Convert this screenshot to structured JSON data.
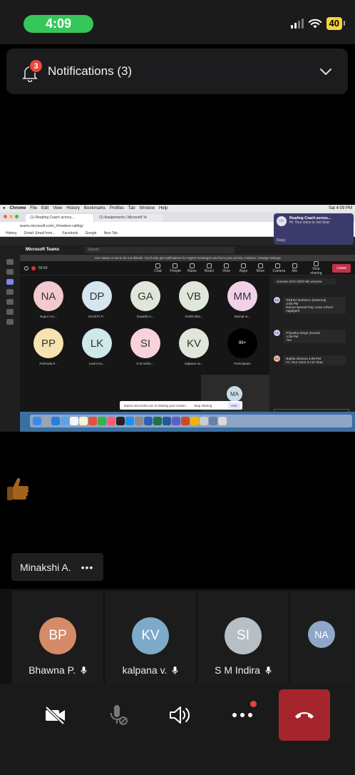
{
  "status_bar": {
    "time": "4:09",
    "battery": "40"
  },
  "notification": {
    "label": "Notifications (3)",
    "badge": "3"
  },
  "shared_screen": {
    "mac_menu": [
      "Chrome",
      "File",
      "Edit",
      "View",
      "History",
      "Bookmarks",
      "Profiles",
      "Tab",
      "Window",
      "Help"
    ],
    "mac_status": "Sat 4:09 PM",
    "tabs": [
      "(1) Reading Coach across...",
      "(1) Assignments | Microsoft Te"
    ],
    "url": "teams.microsoft.com/_#/modern-calling/",
    "bookmarks": [
      "History",
      "Gmail: Email from...",
      "Facebook",
      "Google",
      "New Tab"
    ],
    "mac_notification": {
      "initials": "UU",
      "title": "Reading Coach across...",
      "body": "Hi. Your voice is not clear",
      "reply": "Reply"
    },
    "teams_name": "Microsoft Teams",
    "teams_search": "Search",
    "dnd_banner": "Your status is set to do not disturb. You'll only get notifications for urgent messages and from your priority contacts. Change settings",
    "meeting_timer": "59:43",
    "toolbar": [
      "Chat",
      "People",
      "Raise",
      "React",
      "View",
      "Apps",
      "More",
      "Camera",
      "Mic",
      "Stop sharing"
    ],
    "leave": "Leave",
    "tiles": [
      {
        "initials": "NA",
        "name": "Nupur Aro...",
        "color": "#f2c9cf"
      },
      {
        "initials": "DP",
        "name": "DUHITA P...",
        "color": "#d6e6ef"
      },
      {
        "initials": "GA",
        "name": "Gayathri A...",
        "color": "#dfe7da"
      },
      {
        "initials": "VB",
        "name": "Vrishti Bha...",
        "color": "#dfe7da"
      },
      {
        "initials": "MM",
        "name": "Mamat m...",
        "color": "#f1d1e8"
      },
      {
        "initials": "PP",
        "name": "Parimala P...",
        "color": "#f6e3ad"
      },
      {
        "initials": "LK",
        "name": "Laxmi Ku...",
        "color": "#cde9ea"
      },
      {
        "initials": "SI",
        "name": "S M Indira ...",
        "color": "#f7d3d9"
      },
      {
        "initials": "KV",
        "name": "kalpana va...",
        "color": "#dfe7da"
      }
    ],
    "more_count": "99+",
    "participants_label": "Participants",
    "self_initials": "MA",
    "sharing_text": "teams.microsoft.com is sharing your screen.",
    "stop_sharing": "Stop sharing",
    "hide": "Hide",
    "chat": [
      {
        "initials": "",
        "name": "",
        "time": "",
        "text": "Unmute (Ctrl+Shift+M) veryone"
      },
      {
        "initials": "RB",
        "name": "REENA BANSAL (External)",
        "time": "3:58 PM",
        "text": "Reena Bansal holy cross school najafgarh"
      },
      {
        "initials": "PS",
        "name": "Priyanka Singh (Guest)",
        "time": "4:08 PM",
        "text": "Yes"
      },
      {
        "initials": "BS",
        "name": "Babita Sharma",
        "time": "4:09 PM",
        "text": "Hi. Your voice is not clear"
      }
    ],
    "chat_input": "Type a new message"
  },
  "speaker": {
    "name": "Minakshi A.",
    "menu": "•••"
  },
  "participants": [
    {
      "initials": "BP",
      "name": "Bhawna P.",
      "color": "#d58b68"
    },
    {
      "initials": "KV",
      "name": "kalpana v.",
      "color": "#7eaac9"
    },
    {
      "initials": "SI",
      "name": "S M Indira",
      "color": "#b7bfc4"
    },
    {
      "initials": "NA",
      "name": "",
      "color": "#8fa7c9"
    }
  ],
  "controls": {
    "camera": "camera-off",
    "mic": "mic-off",
    "speaker": "speaker",
    "more": "more",
    "end": "end-call"
  }
}
